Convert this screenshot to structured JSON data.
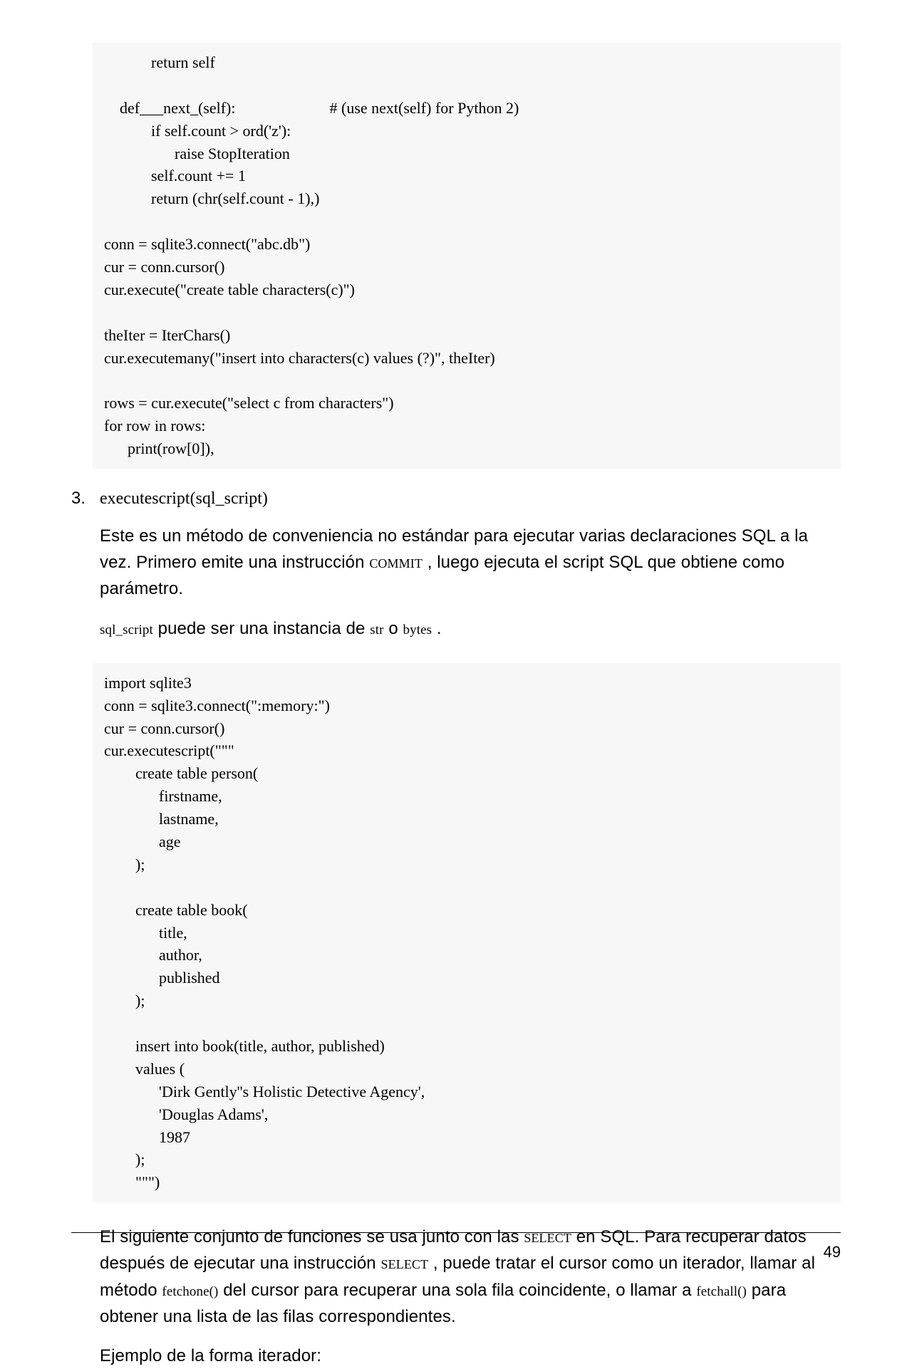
{
  "code_block_1": "            return self\n\n    def___next_(self):                        # (use next(self) for Python 2)\n            if self.count > ord('z'):\n                  raise StopIteration\n            self.count += 1\n            return (chr(self.count - 1),)\n\nconn = sqlite3.connect(\"abc.db\")\ncur = conn.cursor()\ncur.execute(\"create table characters(c)\")\n\ntheIter = IterChars()\ncur.executemany(\"insert into characters(c) values (?)\", theIter)\n\nrows = cur.execute(\"select c from characters\")\nfor row in rows:\n      print(row[0]),",
  "list": {
    "number": "3.",
    "title": "executescript(sql_script)"
  },
  "para1": {
    "t1": "Este es un método de conveniencia no estándar para ejecutar varias declaraciones SQL a la vez. Primero emite una instrucción ",
    "c1": "COMMIT",
    "t2": " , luego ejecuta el script SQL que obtiene como parámetro."
  },
  "para2": {
    "c1": "sql_script",
    "t1": " puede ser una instancia de ",
    "c2": "str",
    "t2": " o ",
    "c3": "bytes",
    "t3": " ."
  },
  "code_block_2": "import sqlite3\nconn = sqlite3.connect(\":memory:\")\ncur = conn.cursor()\ncur.executescript(\"\"\"\n        create table person(\n              firstname,\n              lastname,\n              age\n        );\n\n        create table book(\n              title,\n              author,\n              published\n        );\n\n        insert into book(title, author, published)\n        values (\n              'Dirk Gently''s Holistic Detective Agency',\n              'Douglas Adams',\n              1987\n        );\n        \"\"\")",
  "para3": {
    "t1": "El siguiente conjunto de funciones se usa junto con las ",
    "c1": "SELECT",
    "t2": " en SQL. Para recuperar datos después de ejecutar una instrucción ",
    "c2": "SELECT",
    "t3": " , puede tratar el cursor como un iterador, llamar al método ",
    "c3": "fetchone()",
    "t4": " del cursor para recuperar una sola fila coincidente, o llamar a ",
    "c4": "fetchall()",
    "t5": " para obtener una lista de las filas correspondientes."
  },
  "para4": "Ejemplo de la forma iterador:",
  "page_number": "49"
}
